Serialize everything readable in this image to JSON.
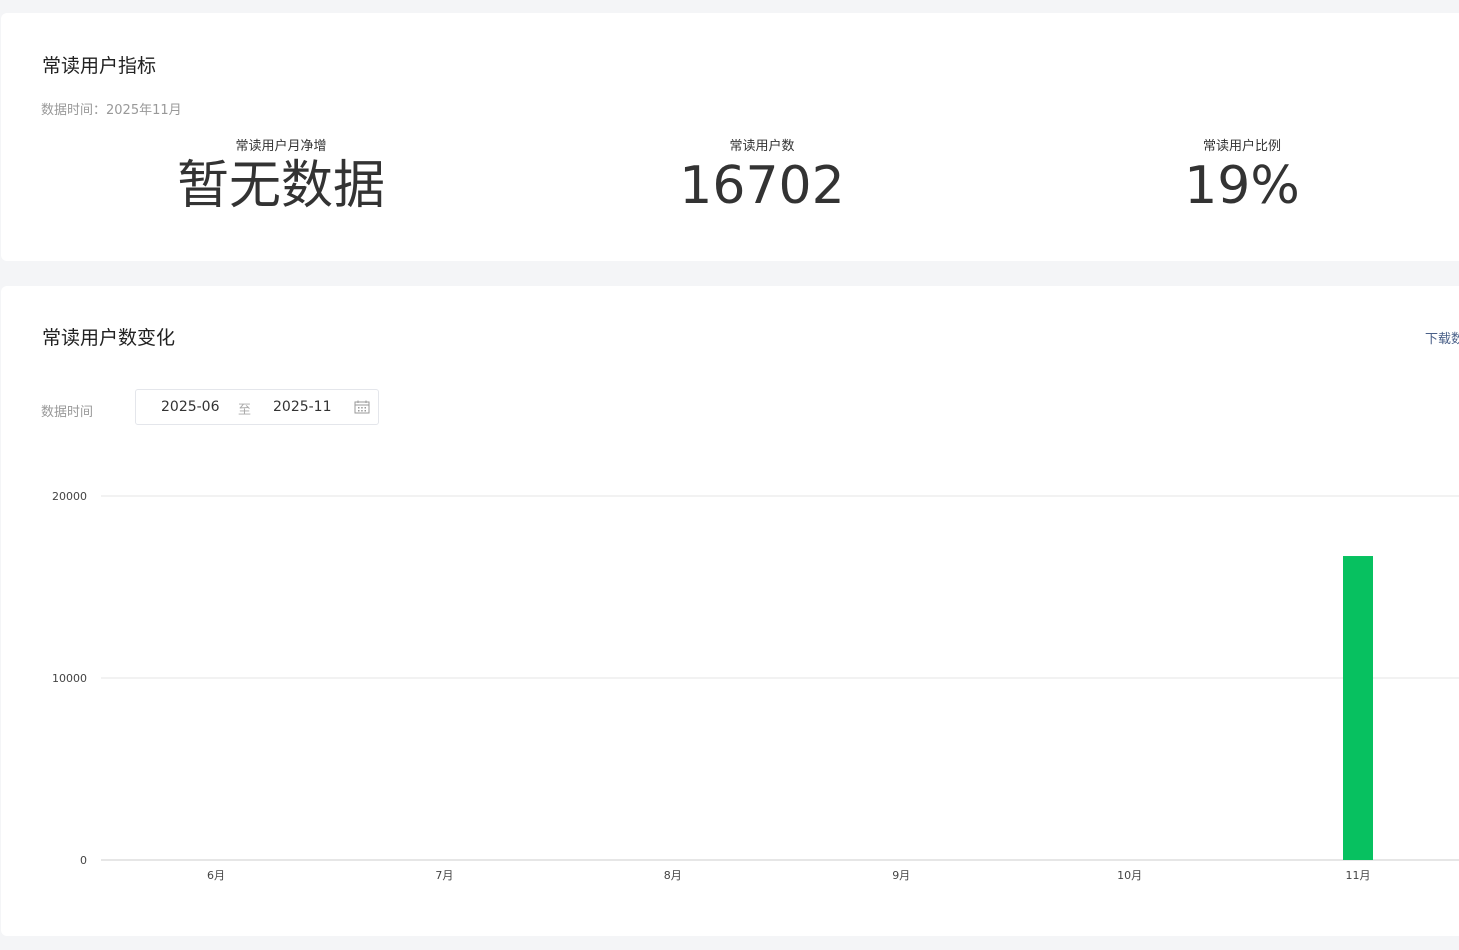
{
  "metrics_card": {
    "title": "常读用户指标",
    "data_time": "数据时间：2025年11月",
    "metrics": [
      {
        "label": "常读用户月净增",
        "value": "暂无数据"
      },
      {
        "label": "常读用户数",
        "value": "16702"
      },
      {
        "label": "常读用户比例",
        "value": "19%"
      }
    ]
  },
  "trend_card": {
    "title": "常读用户数变化",
    "download_label": "下载数据",
    "range_label": "数据时间",
    "date_range": {
      "start": "2025-06",
      "separator": "至",
      "end": "2025-11"
    },
    "calendar_icon": "calendar-icon"
  },
  "colors": {
    "bar": "#07c160",
    "grid": "#e6e6e6"
  },
  "chart_data": {
    "type": "bar",
    "categories": [
      "6月",
      "7月",
      "8月",
      "9月",
      "10月",
      "11月"
    ],
    "values": [
      0,
      0,
      0,
      0,
      0,
      16702
    ],
    "yticks": [
      0,
      10000,
      20000
    ],
    "ylim": [
      0,
      20000
    ],
    "grid": true,
    "legend": "none",
    "title": "",
    "xlabel": "",
    "ylabel": ""
  }
}
